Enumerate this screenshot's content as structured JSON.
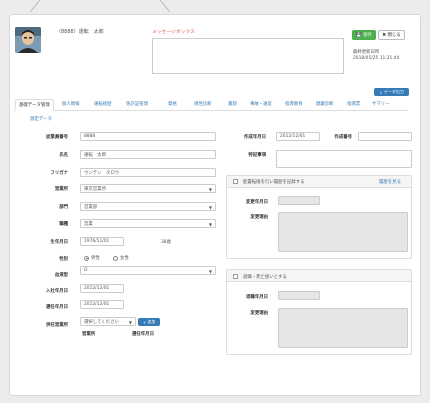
{
  "header": {
    "employee": "（8888）運転　太郎",
    "message_title": "メッセージボックス",
    "save_label": "保存",
    "close_label": "閉じる",
    "last_updated_label": "最終更新日時",
    "last_updated_value": "2018/05/25 11:21:44",
    "export_label": "データ出力"
  },
  "tabs": [
    {
      "label": "基礎データ管理"
    },
    {
      "label": "個人情報"
    },
    {
      "label": "運転経歴"
    },
    {
      "label": "免許証管理"
    },
    {
      "label": "資格"
    },
    {
      "label": "適性診断"
    },
    {
      "label": "賞罰"
    },
    {
      "label": "事故・違反"
    },
    {
      "label": "指導教育"
    },
    {
      "label": "健康診断"
    },
    {
      "label": "指導票"
    },
    {
      "label": "サマリー"
    },
    {
      "label": "測定データ"
    }
  ],
  "form": {
    "employee_no_label": "従業員番号",
    "employee_no": "8888",
    "name_label": "氏名",
    "name": "運転　太郎",
    "kana_label": "フリガナ",
    "kana": "ウンテン　タロウ",
    "office_label": "営業所",
    "office": "東京営業所",
    "dept_label": "部門",
    "dept": "営業部",
    "job_label": "職種",
    "job": "営業",
    "birth_label": "生年月日",
    "birth": "1976/11/01",
    "age": "38歳",
    "gender_label": "性別",
    "gender_male": "男性",
    "gender_female": "女性",
    "blood_label": "血液型",
    "blood": "O",
    "hire_label": "入社年月日",
    "hire": "2012/12/01",
    "appoint_label": "選任年月日",
    "appoint": "2012/12/01",
    "concurrent_label": "併任営業所",
    "concurrent_select": "選択してください",
    "add_label": "追加",
    "col_office": "営業所",
    "col_appoint": "選任年月日",
    "created_label": "作成年月日",
    "created": "2012/12/01",
    "created_no_label": "作成番号",
    "special_label": "特記事項"
  },
  "card1": {
    "checkbox_label": "配置転換を行い履歴を記録する",
    "history_link": "履歴を見る",
    "change_date_label": "変更年月日",
    "change_reason_label": "変更理由"
  },
  "card2": {
    "checkbox_label": "退職・死亡扱いとする",
    "retire_date_label": "退職年月日",
    "change_reason_label": "変更理由"
  }
}
